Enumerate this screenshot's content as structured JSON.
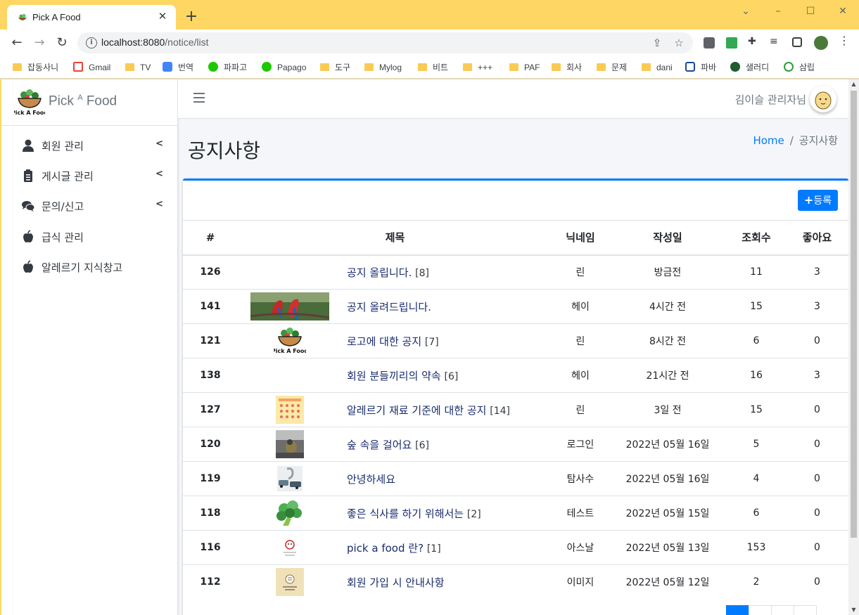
{
  "browser": {
    "tab_title": "Pick A Food",
    "url_host": "localhost:8080",
    "url_path": "/notice/list",
    "bookmarks": [
      {
        "label": "잡동사니",
        "icon": "folder-icon"
      },
      {
        "label": "Gmail",
        "icon": "gmail-icon"
      },
      {
        "label": "TV",
        "icon": "folder-icon"
      },
      {
        "label": "번역",
        "icon": "translate-icon"
      },
      {
        "label": "파파고",
        "icon": "papago-icon"
      },
      {
        "label": "Papago",
        "icon": "papago-icon"
      },
      {
        "label": "도구",
        "icon": "folder-icon"
      },
      {
        "label": "Mylog",
        "icon": "folder-icon"
      },
      {
        "label": "비트",
        "icon": "folder-icon"
      },
      {
        "label": "+++",
        "icon": "folder-icon"
      },
      {
        "label": "PAF",
        "icon": "folder-icon"
      },
      {
        "label": "회사",
        "icon": "folder-icon"
      },
      {
        "label": "문제",
        "icon": "folder-icon"
      },
      {
        "label": "dani",
        "icon": "folder-icon"
      },
      {
        "label": "파바",
        "icon": "pb-icon"
      },
      {
        "label": "샐러디",
        "icon": "salady-icon"
      },
      {
        "label": "삼립",
        "icon": "samlip-icon"
      }
    ]
  },
  "brand": {
    "name": "Pick",
    "sup": "A",
    "name2": "Food",
    "logo_text": "Pick A Food"
  },
  "sidebar": {
    "items": [
      {
        "label": "회원 관리",
        "icon": "user-icon",
        "caret": true
      },
      {
        "label": "게시글 관리",
        "icon": "clipboard-icon",
        "caret": true
      },
      {
        "label": "문의/신고",
        "icon": "comments-icon",
        "caret": true
      },
      {
        "label": "급식 관리",
        "icon": "apple-icon",
        "caret": false
      },
      {
        "label": "알레르기 지식창고",
        "icon": "apple-icon",
        "caret": false
      }
    ]
  },
  "header": {
    "user": "김이슬 관리자님"
  },
  "page": {
    "title": "공지사항",
    "breadcrumb_home": "Home",
    "breadcrumb_sep": "/",
    "breadcrumb_current": "공지사항",
    "add_button": "등록",
    "add_icon": "plus-icon"
  },
  "table": {
    "headers": [
      "#",
      "제목",
      "닉네임",
      "작성일",
      "조회수",
      "좋아요"
    ],
    "rows": [
      {
        "num": "126",
        "thumb": "none",
        "title": "공지 올립니다.",
        "comments": "[8]",
        "nick": "린",
        "date": "방금전",
        "views": "11",
        "likes": "3"
      },
      {
        "num": "141",
        "thumb": "parrots",
        "title": "공지 올려드립니다.",
        "comments": "",
        "nick": "헤이",
        "date": "4시간 전",
        "views": "15",
        "likes": "3"
      },
      {
        "num": "121",
        "thumb": "logo",
        "title": "로고에 대한 공지",
        "comments": "[7]",
        "nick": "린",
        "date": "8시간 전",
        "views": "6",
        "likes": "0"
      },
      {
        "num": "138",
        "thumb": "none",
        "title": "회원 분들끼리의 약속",
        "comments": "[6]",
        "nick": "헤이",
        "date": "21시간 전",
        "views": "16",
        "likes": "3"
      },
      {
        "num": "127",
        "thumb": "allergy-chart",
        "title": "알레르기 재료 기준에 대한 공지",
        "comments": "[14]",
        "nick": "린",
        "date": "3일 전",
        "views": "15",
        "likes": "0"
      },
      {
        "num": "120",
        "thumb": "forest-bird",
        "title": "숲 속을 걸어요",
        "comments": "[6]",
        "nick": "로그인",
        "date": "2022년 05월 16일",
        "views": "5",
        "likes": "0"
      },
      {
        "num": "119",
        "thumb": "cars",
        "title": "안녕하세요",
        "comments": "",
        "nick": "탐사수",
        "date": "2022년 05월 16일",
        "views": "4",
        "likes": "0"
      },
      {
        "num": "118",
        "thumb": "broccoli",
        "title": "좋은 식사를 하기 위해서는",
        "comments": "[2]",
        "nick": "테스트",
        "date": "2022년 05월 15일",
        "views": "6",
        "likes": "0"
      },
      {
        "num": "116",
        "thumb": "sketch",
        "title": "pick a food 란?",
        "comments": "[1]",
        "nick": "아스날",
        "date": "2022년 05월 13일",
        "views": "153",
        "likes": "0"
      },
      {
        "num": "112",
        "thumb": "beige-card",
        "title": "회원 가입 시 안내사항",
        "comments": "",
        "nick": "이미지",
        "date": "2022년 05월 12일",
        "views": "2",
        "likes": "0"
      }
    ]
  },
  "colors": {
    "accent": "#007bff",
    "titlebar": "#fdd663"
  }
}
